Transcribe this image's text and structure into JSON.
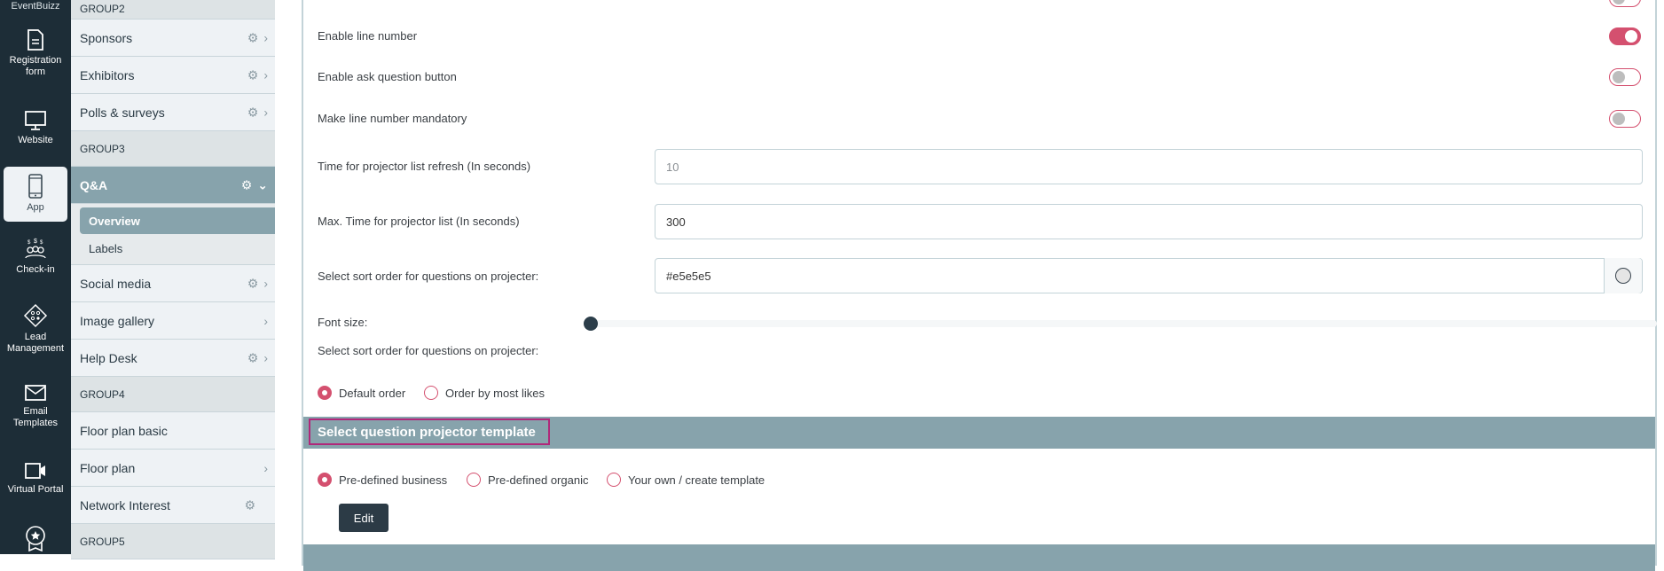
{
  "app": {
    "brand": "EventBuizz"
  },
  "iconbar": {
    "items": [
      {
        "label": "Registration form",
        "icon": "document-icon"
      },
      {
        "label": "Website",
        "icon": "monitor-icon"
      },
      {
        "label": "App",
        "icon": "mobile-icon",
        "active": true
      },
      {
        "label": "Check-in",
        "icon": "people-icon"
      },
      {
        "label": "Lead Management",
        "icon": "ticket-icon"
      },
      {
        "label": "Email Templates",
        "icon": "envelope-icon"
      },
      {
        "label": "Virtual Portal",
        "icon": "video-icon"
      },
      {
        "label": "",
        "icon": "badge-icon"
      }
    ]
  },
  "menu": {
    "group2": "GROUP2",
    "sponsors": "Sponsors",
    "exhibitors": "Exhibitors",
    "polls": "Polls & surveys",
    "group3": "GROUP3",
    "qa": "Q&A",
    "overview": "Overview",
    "labels": "Labels",
    "social": "Social media",
    "gallery": "Image gallery",
    "helpdesk": "Help Desk",
    "group4": "GROUP4",
    "floorbasic": "Floor plan basic",
    "floor": "Floor plan",
    "network": "Network Interest",
    "group5": "GROUP5"
  },
  "settings": {
    "toggles": [
      {
        "label": "Enable line number",
        "on": true
      },
      {
        "label": "Enable ask question button",
        "on": false
      },
      {
        "label": "Make line number mandatory",
        "on": false
      }
    ],
    "refresh": {
      "label": "Time for projector list refresh (In seconds)",
      "placeholder": "10"
    },
    "maxtime": {
      "label": "Max. Time for projector list (In seconds)",
      "value": "300"
    },
    "color": {
      "label": "Select sort order for questions on projecter:",
      "value": "#e5e5e5"
    },
    "fontsize": {
      "label": "Font size:",
      "value_fraction": 0.0
    },
    "sortorder": {
      "label": "Select sort order for questions on projecter:",
      "options": [
        {
          "label": "Default order",
          "selected": true
        },
        {
          "label": "Order by most likes",
          "selected": false
        }
      ]
    }
  },
  "template_section": {
    "title": "Select question projector template",
    "options": [
      {
        "label": "Pre-defined business",
        "selected": true
      },
      {
        "label": "Pre-defined organic",
        "selected": false
      },
      {
        "label": "Your own / create template",
        "selected": false
      }
    ],
    "edit_label": "Edit"
  },
  "colors": {
    "accent": "#d4506f",
    "sidebar": "#1d2d37",
    "section": "#87a3ac",
    "highlight_border": "#b0287a"
  }
}
